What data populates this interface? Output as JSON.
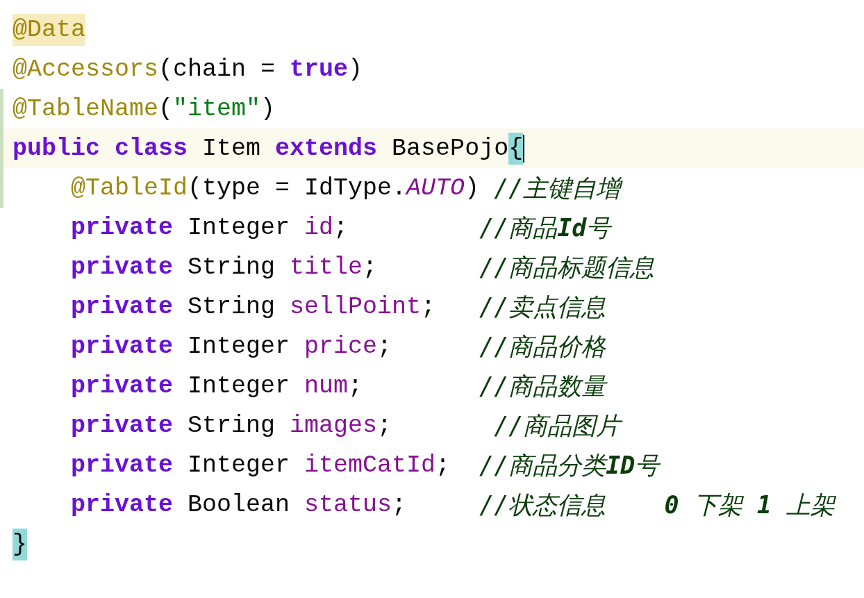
{
  "editor": {
    "lines": [
      {
        "changed": false,
        "current": false,
        "indented": false,
        "tokens": [
          {
            "kind": "annotation",
            "text": "@Data",
            "highlighted": true
          }
        ]
      },
      {
        "changed": false,
        "current": false,
        "indented": false,
        "tokens": [
          {
            "kind": "annotation",
            "text": "@Accessors"
          },
          {
            "kind": "plain",
            "text": "(chain = "
          },
          {
            "kind": "keyword",
            "text": "true"
          },
          {
            "kind": "plain",
            "text": ")"
          }
        ]
      },
      {
        "changed": true,
        "current": false,
        "indented": false,
        "tokens": [
          {
            "kind": "annotation",
            "text": "@TableName"
          },
          {
            "kind": "plain",
            "text": "("
          },
          {
            "kind": "string",
            "text": "\"item\""
          },
          {
            "kind": "plain",
            "text": ")"
          }
        ]
      },
      {
        "changed": true,
        "current": true,
        "indented": false,
        "tokens": [
          {
            "kind": "keyword",
            "text": "public class "
          },
          {
            "kind": "plain",
            "text": "Item "
          },
          {
            "kind": "keyword",
            "text": "extends "
          },
          {
            "kind": "plain",
            "text": "BasePojo"
          },
          {
            "kind": "plain",
            "text": "{",
            "highlighted": true
          }
        ]
      },
      {
        "changed": true,
        "current": false,
        "indented": true,
        "tokens": [
          {
            "kind": "annotation",
            "text": "@TableId"
          },
          {
            "kind": "plain",
            "text": "(type = IdType."
          },
          {
            "kind": "constant",
            "text": "AUTO"
          },
          {
            "kind": "plain",
            "text": ") "
          },
          {
            "kind": "comment",
            "text": "//主键自增"
          }
        ]
      },
      {
        "changed": false,
        "current": false,
        "indented": true,
        "tokens": [
          {
            "kind": "keyword",
            "text": "private "
          },
          {
            "kind": "plain",
            "text": "Integer "
          },
          {
            "kind": "field",
            "text": "id"
          },
          {
            "kind": "plain",
            "text": ";         "
          },
          {
            "kind": "comment",
            "text": "//商品**Id**号"
          }
        ]
      },
      {
        "changed": false,
        "current": false,
        "indented": true,
        "tokens": [
          {
            "kind": "keyword",
            "text": "private "
          },
          {
            "kind": "plain",
            "text": "String "
          },
          {
            "kind": "field",
            "text": "title"
          },
          {
            "kind": "plain",
            "text": ";       "
          },
          {
            "kind": "comment",
            "text": "//商品标题信息"
          }
        ]
      },
      {
        "changed": false,
        "current": false,
        "indented": true,
        "tokens": [
          {
            "kind": "keyword",
            "text": "private "
          },
          {
            "kind": "plain",
            "text": "String "
          },
          {
            "kind": "field",
            "text": "sellPoint"
          },
          {
            "kind": "plain",
            "text": ";   "
          },
          {
            "kind": "comment",
            "text": "//卖点信息"
          }
        ]
      },
      {
        "changed": false,
        "current": false,
        "indented": true,
        "tokens": [
          {
            "kind": "keyword",
            "text": "private "
          },
          {
            "kind": "plain",
            "text": "Integer "
          },
          {
            "kind": "field",
            "text": "price"
          },
          {
            "kind": "plain",
            "text": ";      "
          },
          {
            "kind": "comment",
            "text": "//商品价格"
          }
        ]
      },
      {
        "changed": false,
        "current": false,
        "indented": true,
        "tokens": [
          {
            "kind": "keyword",
            "text": "private "
          },
          {
            "kind": "plain",
            "text": "Integer "
          },
          {
            "kind": "field",
            "text": "num"
          },
          {
            "kind": "plain",
            "text": ";        "
          },
          {
            "kind": "comment",
            "text": "//商品数量"
          }
        ]
      },
      {
        "changed": false,
        "current": false,
        "indented": true,
        "tokens": [
          {
            "kind": "keyword",
            "text": "private "
          },
          {
            "kind": "plain",
            "text": "String "
          },
          {
            "kind": "field",
            "text": "images"
          },
          {
            "kind": "plain",
            "text": ";       "
          },
          {
            "kind": "comment",
            "text": "//商品图片"
          }
        ]
      },
      {
        "changed": false,
        "current": false,
        "indented": true,
        "tokens": [
          {
            "kind": "keyword",
            "text": "private "
          },
          {
            "kind": "plain",
            "text": "Integer "
          },
          {
            "kind": "field",
            "text": "itemCatId"
          },
          {
            "kind": "plain",
            "text": ";  "
          },
          {
            "kind": "comment",
            "text": "//商品分类**ID**号"
          }
        ]
      },
      {
        "changed": false,
        "current": false,
        "indented": true,
        "tokens": [
          {
            "kind": "keyword",
            "text": "private "
          },
          {
            "kind": "plain",
            "text": "Boolean "
          },
          {
            "kind": "field",
            "text": "status"
          },
          {
            "kind": "plain",
            "text": ";     "
          },
          {
            "kind": "comment",
            "text": "//状态信息    **0** 下架 **1** 上架"
          }
        ]
      },
      {
        "changed": false,
        "current": false,
        "indented": false,
        "tokens": [
          {
            "kind": "plain",
            "text": "}",
            "highlighted": true
          }
        ]
      }
    ]
  }
}
